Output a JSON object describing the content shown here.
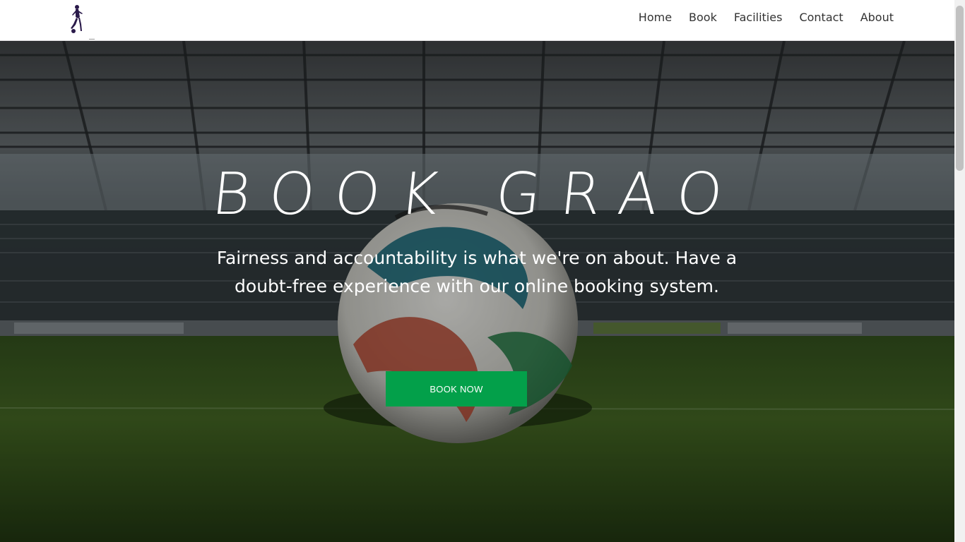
{
  "nav": {
    "items": [
      {
        "label": "Home"
      },
      {
        "label": "Book"
      },
      {
        "label": "Facilities"
      },
      {
        "label": "Contact"
      },
      {
        "label": "About"
      }
    ]
  },
  "logo": {
    "icon": "soccer-player-icon"
  },
  "hero": {
    "title": "BOOK GRAO",
    "subtitle": "Fairness and accountability is what we're on about. Have a doubt-free experience with our online booking system.",
    "cta_label": "BOOK NOW",
    "background": "stadium-with-soccer-ball-photo"
  },
  "colors": {
    "accent": "#03a04a",
    "nav_text": "#333333",
    "hero_text": "#ffffff"
  }
}
